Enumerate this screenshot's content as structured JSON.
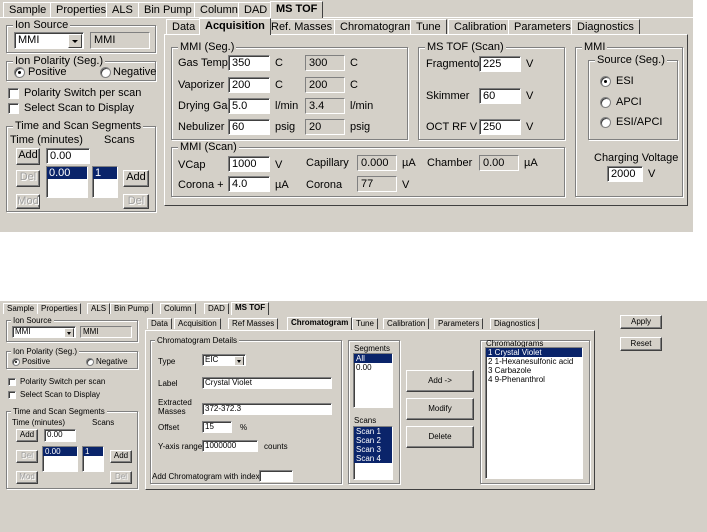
{
  "top": {
    "tabs": [
      "Sample",
      "Properties",
      "ALS",
      "Bin Pump",
      "Column",
      "DAD",
      "MS TOF"
    ],
    "left": {
      "ion_source_title": "Ion Source",
      "ion_source_value": "MMI",
      "ion_source_readout": "MMI",
      "polarity_title": "Ion Polarity (Seg.)",
      "positive": "Positive",
      "negative": "Negative",
      "polarity_switch": "Polarity Switch per scan",
      "select_scan": "Select Scan to Display",
      "segments_title": "Time and Scan Segments",
      "time_label": "Time  (minutes)",
      "scans_label": "Scans",
      "add": "Add",
      "time_value": "0.00",
      "del": "Del",
      "mod": "Mod",
      "seg_list": [
        "0.00"
      ],
      "scan_list": [
        "1"
      ],
      "add2": "Add",
      "del2": "Del"
    },
    "subtabs": [
      "Data",
      "Acquisition",
      "Ref. Masses",
      "Chromatogram",
      "Tune",
      "Calibration",
      "Parameters",
      "Diagnostics"
    ],
    "mmi_seg": {
      "title": "MMI (Seg.)",
      "rows": [
        {
          "label": "Gas Temp",
          "value": "350",
          "unit": "C",
          "actual": "300",
          "aunit": "C"
        },
        {
          "label": "Vaporizer",
          "value": "200",
          "unit": "C",
          "actual": "200",
          "aunit": "C"
        },
        {
          "label": "Drying Gas",
          "value": "5.0",
          "unit": "l/min",
          "actual": "3.4",
          "aunit": "l/min"
        },
        {
          "label": "Nebulizer",
          "value": "60",
          "unit": "psig",
          "actual": "20",
          "aunit": "psig"
        }
      ]
    },
    "mstof_scan": {
      "title": "MS TOF (Scan)",
      "rows": [
        {
          "label": "Fragmentor",
          "value": "225",
          "unit": "V"
        },
        {
          "label": "Skimmer",
          "value": "60",
          "unit": "V"
        },
        {
          "label": "OCT RF V",
          "value": "250",
          "unit": "V"
        }
      ]
    },
    "mmi_right": {
      "title": "MMI",
      "source_title": "Source (Seg.)",
      "options": [
        "ESI",
        "APCI",
        "ESI/APCI"
      ],
      "charging_label": "Charging Voltage",
      "charging_value": "2000",
      "charging_unit": "V"
    },
    "mmi_scan": {
      "title": "MMI (Scan)",
      "vcap_label": "VCap",
      "vcap_value": "1000",
      "vcap_unit": "V",
      "capillary_label": "Capillary",
      "capillary_value": "0.000",
      "capillary_unit": "µA",
      "chamber_label": "Chamber",
      "chamber_value": "0.00",
      "chamber_unit": "µA",
      "corona_plus_label": "Corona +",
      "corona_plus_value": "4.0",
      "corona_plus_unit": "µA",
      "corona_label": "Corona",
      "corona_value": "77",
      "corona_unit": "V"
    }
  },
  "bottom": {
    "tabs": [
      "Sample",
      "Properties",
      "ALS",
      "Bin Pump",
      "Column",
      "DAD",
      "MS TOF"
    ],
    "left": {
      "ion_source_title": "Ion Source",
      "ion_source_value": "MMI",
      "ion_source_readout": "MMI",
      "polarity_title": "Ion Polarity (Seg.)",
      "positive": "Positive",
      "negative": "Negative",
      "polarity_switch": "Polarity Switch per scan",
      "select_scan": "Select Scan to Display",
      "segments_title": "Time and Scan Segments",
      "time_label": "Time  (minutes)",
      "scans_label": "Scans",
      "add": "Add",
      "time_value": "0.00",
      "del": "Del",
      "mod": "Mod",
      "seg_list": [
        "0.00"
      ],
      "scan_list": [
        "1"
      ],
      "add2": "Add",
      "del2": "Del"
    },
    "subtabs": [
      "Data",
      "Acquisition",
      "Ref Masses",
      "Chromatogram",
      "Tune",
      "Calibration",
      "Parameters",
      "Diagnostics"
    ],
    "apply": "Apply",
    "reset": "Reset",
    "chrom_details": {
      "title": "Chromatogram Details",
      "type_label": "Type",
      "type_value": "EIC",
      "label_label": "Label",
      "label_value": "Crystal Violet",
      "extracted_label": "Extracted\nMasses",
      "extracted_value": "372-372.3",
      "offset_label": "Offset",
      "offset_value": "15",
      "offset_unit": "%",
      "yrange_label": "Y-axis range",
      "yrange_value": "1000000",
      "yrange_unit": "counts"
    },
    "add_with_index_label": "Add Chromatogram with index",
    "segments_title": "Segments",
    "segments": [
      "All",
      "0.00"
    ],
    "scans_title": "Scans",
    "scans": [
      "Scan 1",
      "Scan 2",
      "Scan 3",
      "Scan 4"
    ],
    "add_arrow": "Add ->",
    "modify": "Modify",
    "delete": "Delete",
    "chromatograms_title": "Chromatograms",
    "chromatograms": [
      "1 Crystal Violet",
      "2 1-Hexanesulfonic acid",
      "3 Carbazole",
      "4 9-Phenanthrol"
    ]
  }
}
